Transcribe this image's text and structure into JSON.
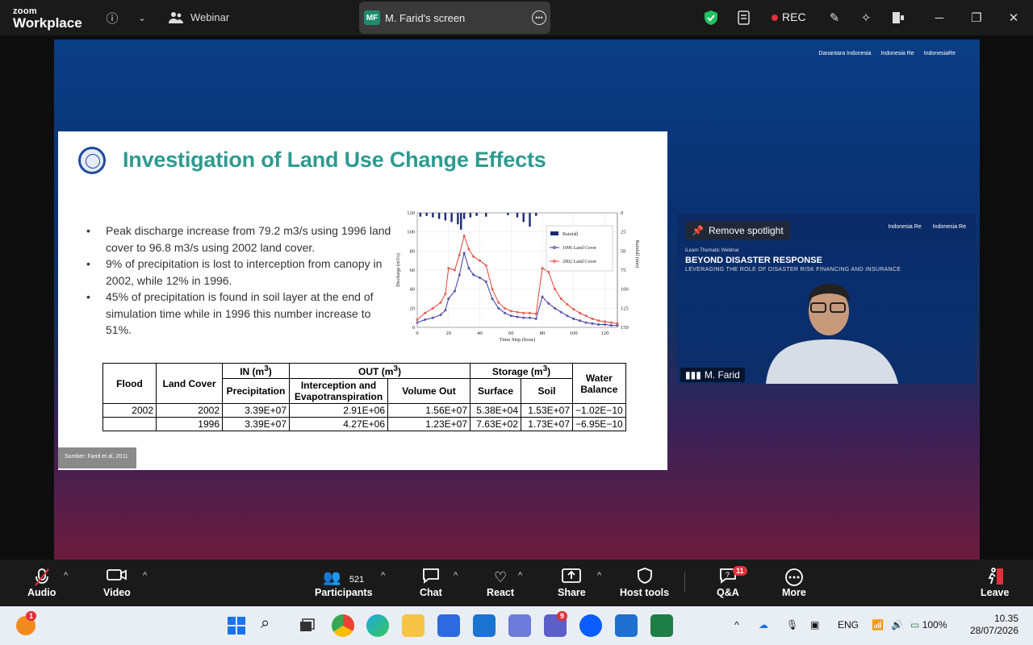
{
  "app": {
    "brand_line1": "zoom",
    "brand_line2": "Workplace",
    "meeting_type": "Webinar"
  },
  "screen_share": {
    "initials": "MF",
    "label": "M. Farid's screen"
  },
  "topbar": {
    "rec_label": "REC"
  },
  "slide": {
    "title": "Investigation of Land Use Change Effects",
    "bullets": [
      "Peak discharge increase from 79.2 m3/s using 1996 land cover to 96.8 m3/s using 2002 land cover.",
      "9% of precipitation is lost to interception from canopy in 2002, while 12% in 1996.",
      "45% of precipitation is found in soil layer at the end of simulation time while in 1996 this number increase to 51%."
    ],
    "source": "Sumber: Farid et al, 2011",
    "logos": [
      "Danantara Indonesia",
      "Indonesia Re",
      "IndonesiaRe"
    ],
    "table": {
      "headers": {
        "flood": "Flood",
        "land_cover": "Land Cover",
        "in": "IN (m",
        "out": "OUT (m",
        "storage": "Storage (m",
        "water_balance": "Water Balance",
        "precip": "Precipitation",
        "interception": "Interception and Evapotranspiration",
        "volume_out": "Volume Out",
        "surface": "Surface",
        "soil": "Soil",
        "sup": "3",
        "close": ")"
      },
      "rows": [
        [
          "2002",
          "2002",
          "3.39E+07",
          "2.91E+06",
          "1.56E+07",
          "5.38E+04",
          "1.53E+07",
          "−1.02E−10"
        ],
        [
          "",
          "1996",
          "3.39E+07",
          "4.27E+06",
          "1.23E+07",
          "7.63E+02",
          "1.73E+07",
          "−6.95E−10"
        ]
      ]
    }
  },
  "chart_data": {
    "type": "line",
    "xlabel": "Time Step (hour)",
    "ylabel": "Discharge (m3/s)",
    "y2label": "Rainfall (mm)",
    "xlim": [
      0,
      128
    ],
    "ylim": [
      0,
      120
    ],
    "y2lim": [
      0,
      150
    ],
    "x_ticks": [
      0,
      20,
      40,
      60,
      80,
      100,
      120
    ],
    "y_ticks": [
      0,
      20,
      40,
      60,
      80,
      100,
      120
    ],
    "y2_ticks": [
      0,
      25,
      50,
      75,
      100,
      125,
      150
    ],
    "legend": [
      "Rainfall",
      "1996 Land Cover",
      "2002 Land Cover"
    ],
    "legend_position": "top-right",
    "series": [
      {
        "name": "1996 Land Cover",
        "x": [
          0,
          5,
          10,
          15,
          18,
          20,
          24,
          27,
          30,
          33,
          36,
          40,
          44,
          48,
          52,
          56,
          60,
          64,
          68,
          72,
          76,
          80,
          84,
          88,
          92,
          96,
          100,
          104,
          108,
          112,
          116,
          120,
          124,
          128
        ],
        "values": [
          5,
          8,
          10,
          13,
          18,
          30,
          38,
          55,
          78,
          62,
          55,
          52,
          48,
          30,
          20,
          15,
          12,
          11,
          10,
          10,
          9,
          32,
          25,
          20,
          16,
          12,
          9,
          7,
          5,
          4,
          3,
          3,
          2,
          2
        ]
      },
      {
        "name": "2002 Land Cover",
        "x": [
          0,
          5,
          10,
          15,
          18,
          20,
          24,
          27,
          30,
          33,
          36,
          40,
          44,
          48,
          52,
          56,
          60,
          64,
          68,
          72,
          76,
          80,
          84,
          88,
          92,
          96,
          100,
          104,
          108,
          112,
          116,
          120,
          124,
          128
        ],
        "values": [
          8,
          15,
          20,
          26,
          35,
          62,
          60,
          76,
          96,
          82,
          74,
          70,
          65,
          40,
          26,
          20,
          17,
          16,
          15,
          15,
          14,
          62,
          58,
          40,
          30,
          24,
          19,
          15,
          12,
          9,
          7,
          6,
          5,
          4
        ]
      },
      {
        "name": "Rainfall",
        "x": [
          2,
          6,
          10,
          14,
          18,
          22,
          26,
          28,
          30,
          34,
          38,
          44,
          58,
          64,
          68,
          72,
          76
        ],
        "values": [
          5,
          4,
          6,
          8,
          10,
          12,
          15,
          22,
          8,
          6,
          4,
          5,
          3,
          6,
          12,
          18,
          4
        ]
      }
    ]
  },
  "video_tile": {
    "spotlight_label": "Remove spotlight",
    "line1": "iLearn Thematic Webinar",
    "line2": "BEYOND DISASTER RESPONSE",
    "line3": "LEVERAGING THE ROLE OF DISASTER RISK FINANCING AND INSURANCE",
    "logos": [
      "Indonesia Re",
      "Indonesia Re"
    ],
    "participant_name": "M. Farid"
  },
  "controls": {
    "audio": "Audio",
    "video": "Video",
    "participants": "Participants",
    "participants_count": "521",
    "chat": "Chat",
    "react": "React",
    "share": "Share",
    "host_tools": "Host tools",
    "qa": "Q&A",
    "qa_badge": "11",
    "more": "More",
    "leave": "Leave"
  },
  "taskbar": {
    "notif_badge": "1",
    "teams_badge": "9",
    "lang": "ENG",
    "battery": "100%",
    "time": "10.35",
    "date": "28/07/2026"
  },
  "colors": {
    "accent_green": "#2e9a90",
    "rec_red": "#e0303a",
    "series_1996": "#3a3aa0",
    "series_2002": "#e0453a",
    "rainfall": "#1c2a78"
  }
}
